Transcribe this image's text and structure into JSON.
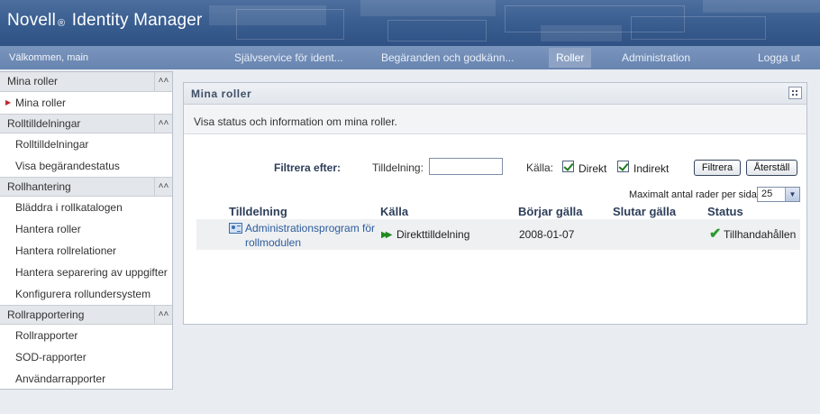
{
  "app": {
    "logo_text": "Novell",
    "logo_reg": "®",
    "logo_product": "Identity Manager"
  },
  "navbar": {
    "welcome": "Välkommen, main",
    "tabs": [
      {
        "label": "Självservice för ident..."
      },
      {
        "label": "Begäranden och godkänn..."
      },
      {
        "label": "Roller"
      },
      {
        "label": "Administration"
      },
      {
        "label": "Logga ut"
      }
    ],
    "active_tab": "Roller"
  },
  "sidebar": {
    "sections": [
      {
        "title": "Mina roller",
        "items": [
          "Mina roller"
        ]
      },
      {
        "title": "Rolltilldelningar",
        "items": [
          "Rolltilldelningar",
          "Visa begärandestatus"
        ]
      },
      {
        "title": "Rollhantering",
        "items": [
          "Bläddra i rollkatalogen",
          "Hantera roller",
          "Hantera rollrelationer",
          "Hantera separering av uppgifter",
          "Konfigurera rollundersystem"
        ]
      },
      {
        "title": "Rollrapportering",
        "items": [
          "Rollrapporter",
          "SOD-rapporter",
          "Användarrapporter"
        ]
      }
    ],
    "selected_item": "Mina roller"
  },
  "panel": {
    "title": "Mina roller",
    "description": "Visa status och information om mina roller.",
    "filter": {
      "label": "Filtrera efter:",
      "assignment_label": "Tilldelning:",
      "assignment_value": "",
      "source_label": "Källa:",
      "direct_label": "Direkt",
      "direct_checked": true,
      "indirect_label": "Indirekt",
      "indirect_checked": true,
      "filter_button": "Filtrera",
      "reset_button": "Återställ"
    },
    "max_rows_label": "Maximalt antal rader per sida",
    "max_rows_value": "25",
    "table": {
      "headers": {
        "assignment": "Tilldelning",
        "source": "Källa",
        "starts": "Börjar gälla",
        "ends": "Slutar gälla",
        "status": "Status"
      },
      "rows": [
        {
          "assignment": "Administrationsprogram för rollmodulen",
          "source": "Direkttilldelning",
          "starts": "2008-01-07",
          "ends": "",
          "status": "Tillhandahållen"
        }
      ]
    }
  },
  "icons": {
    "collapse": "double-chevron-up-icon",
    "role": "role-icon",
    "direct_source": "double-arrow-right-icon",
    "status_ok": "checkmark-icon"
  },
  "colors": {
    "header": "#3b5f91",
    "nav": "#6784b0",
    "link": "#2b5c9c",
    "checkmark": "#2c9a2c",
    "sidebar_marker": "#c0272d"
  }
}
